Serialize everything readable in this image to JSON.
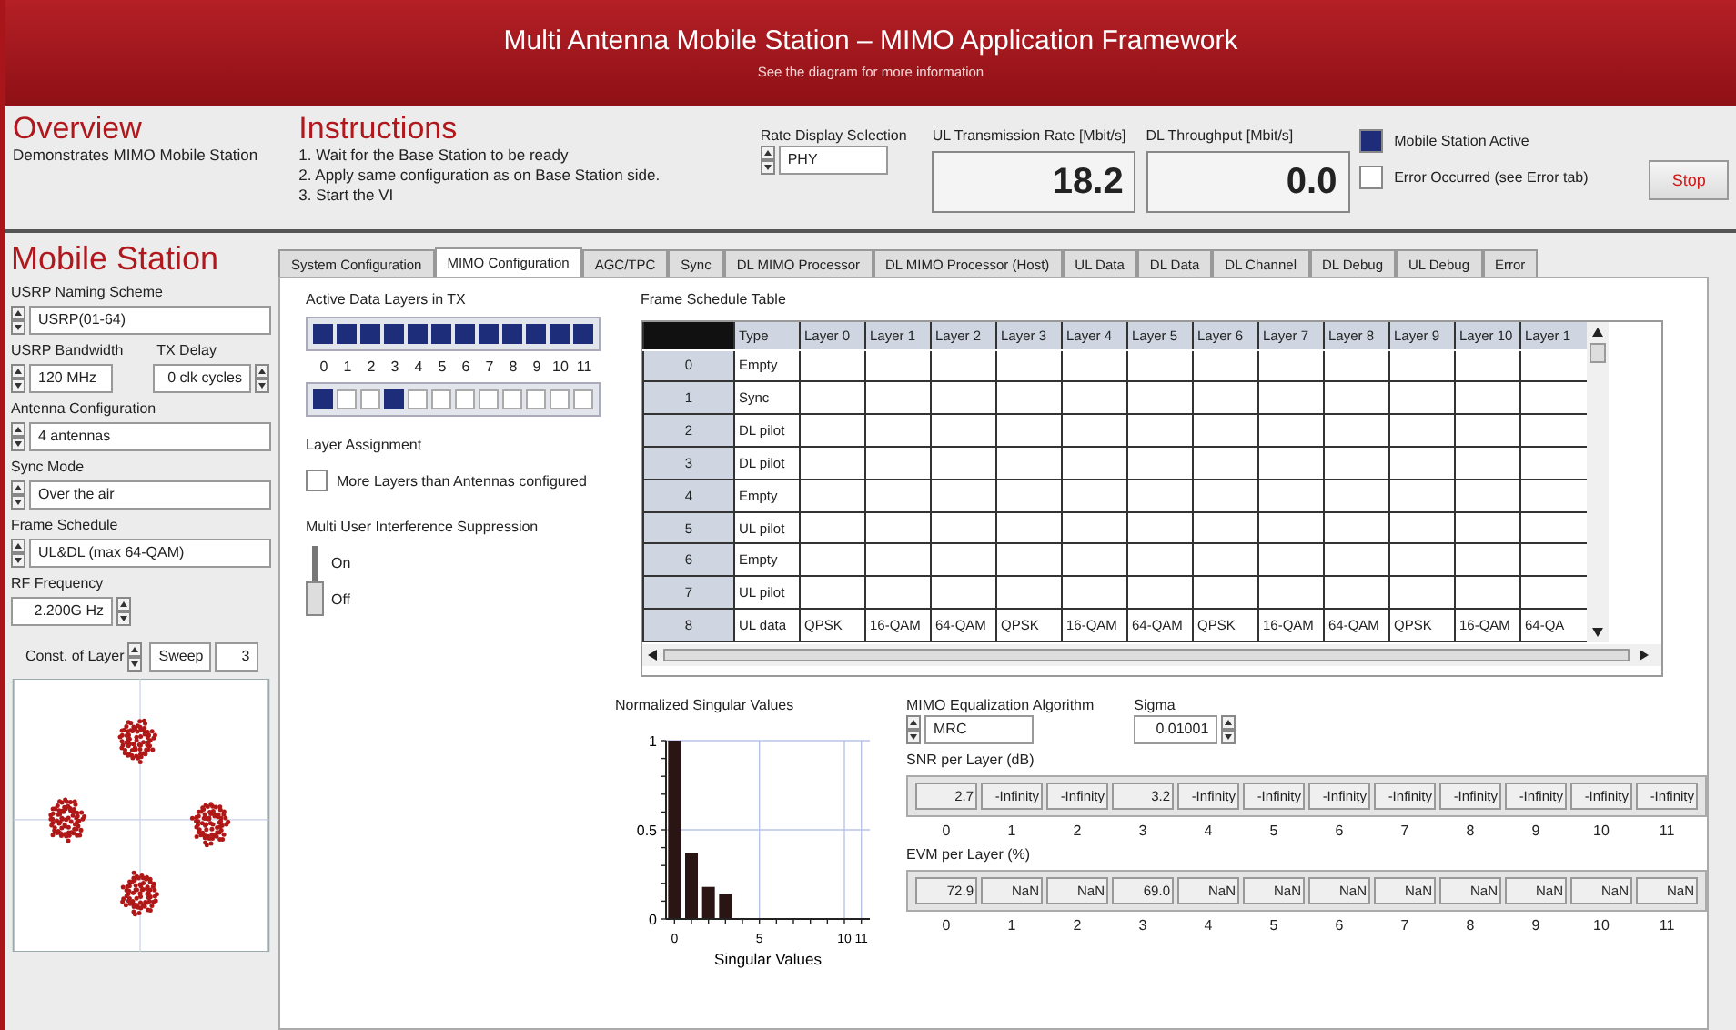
{
  "header": {
    "title": "Multi Antenna Mobile Station – MIMO Application Framework",
    "subtitle": "See the diagram for more information"
  },
  "overview": {
    "heading": "Overview",
    "text": "Demonstrates MIMO Mobile Station"
  },
  "instructions": {
    "heading": "Instructions",
    "steps": [
      "1. Wait for the Base Station to be ready",
      "2. Apply same configuration as on Base Station side.",
      "3. Start the VI"
    ]
  },
  "rate_display": {
    "label": "Rate Display Selection",
    "value": "PHY"
  },
  "indicators": [
    {
      "label": "UL Transmission Rate [Mbit/s]",
      "value": "18.2"
    },
    {
      "label": "DL Throughput [Mbit/s]",
      "value": "0.0"
    }
  ],
  "status_leds": [
    {
      "label": "Mobile Station Active",
      "on": true
    },
    {
      "label": "Error Occurred (see Error tab)",
      "on": false
    }
  ],
  "stop_button": "Stop",
  "mobile_station": {
    "heading": "Mobile Station",
    "naming_scheme": {
      "label": "USRP Naming Scheme",
      "value": "USRP(01-64)"
    },
    "bandwidth": {
      "label": "USRP Bandwidth",
      "value": "120 MHz"
    },
    "tx_delay": {
      "label": "TX Delay",
      "value": "0 clk cycles"
    },
    "antenna_config": {
      "label": "Antenna Configuration",
      "value": "4 antennas"
    },
    "sync_mode": {
      "label": "Sync Mode",
      "value": "Over the air"
    },
    "frame_schedule": {
      "label": "Frame Schedule",
      "value": "UL&DL (max 64-QAM)"
    },
    "rf_frequency": {
      "label": "RF Frequency",
      "value": "2.200G Hz"
    },
    "constellation": {
      "label": "Const. of Layer",
      "mode": "Sweep",
      "layer": "3"
    }
  },
  "tabs": [
    {
      "label": "System Configuration",
      "selected": false
    },
    {
      "label": "MIMO Configuration",
      "selected": true
    },
    {
      "label": "AGC/TPC",
      "selected": false
    },
    {
      "label": "Sync",
      "selected": false
    },
    {
      "label": "DL MIMO Processor",
      "selected": false
    },
    {
      "label": "DL MIMO Processor (Host)",
      "selected": false
    },
    {
      "label": "UL Data",
      "selected": false
    },
    {
      "label": "DL Data",
      "selected": false
    },
    {
      "label": "DL Channel",
      "selected": false
    },
    {
      "label": "DL Debug",
      "selected": false
    },
    {
      "label": "UL Debug",
      "selected": false
    },
    {
      "label": "Error",
      "selected": false
    }
  ],
  "active_layers": {
    "label": "Active Data Layers in TX",
    "tx": [
      true,
      true,
      true,
      true,
      true,
      true,
      true,
      true,
      true,
      true,
      true,
      true
    ],
    "indices": [
      "0",
      "1",
      "2",
      "3",
      "4",
      "5",
      "6",
      "7",
      "8",
      "9",
      "10",
      "11"
    ],
    "assignment": [
      true,
      false,
      false,
      true,
      false,
      false,
      false,
      false,
      false,
      false,
      false,
      false
    ],
    "assignment_label": "Layer Assignment"
  },
  "more_layers": {
    "label": "More Layers than Antennas configured",
    "checked": false
  },
  "interference": {
    "label": "Multi User Interference Suppression",
    "on": false,
    "on_label": "On",
    "off_label": "Off"
  },
  "frame_table": {
    "title": "Frame Schedule Table",
    "columns": [
      "Type",
      "Layer 0",
      "Layer 1",
      "Layer 2",
      "Layer 3",
      "Layer 4",
      "Layer 5",
      "Layer 6",
      "Layer 7",
      "Layer 8",
      "Layer 9",
      "Layer 10",
      "Layer 1"
    ],
    "rows": [
      {
        "index": "0",
        "type": "Empty"
      },
      {
        "index": "1",
        "type": "Sync"
      },
      {
        "index": "2",
        "type": "DL pilot"
      },
      {
        "index": "3",
        "type": "DL pilot"
      },
      {
        "index": "4",
        "type": "Empty"
      },
      {
        "index": "5",
        "type": "UL pilot"
      },
      {
        "index": "6",
        "type": "Empty"
      },
      {
        "index": "7",
        "type": "UL pilot"
      },
      {
        "index": "8",
        "type": "UL data",
        "cells": [
          "QPSK",
          "16-QAM",
          "64-QAM",
          "QPSK",
          "16-QAM",
          "64-QAM",
          "QPSK",
          "16-QAM",
          "64-QAM",
          "QPSK",
          "16-QAM",
          "64-QA"
        ]
      }
    ]
  },
  "singular_values": {
    "chart_data": {
      "type": "bar",
      "title": "Normalized Singular Values",
      "xlabel": "Singular Values",
      "x": [
        0,
        1,
        2,
        3
      ],
      "values": [
        1,
        0.37,
        0.18,
        0.14
      ],
      "xlim": [
        -0.5,
        11.5
      ],
      "ylim": [
        0,
        1
      ],
      "xticks": [
        0,
        5,
        10,
        11
      ],
      "yticks": [
        0,
        0.5,
        1
      ],
      "grid": true
    }
  },
  "equalization": {
    "label": "MIMO Equalization Algorithm",
    "value": "MRC"
  },
  "sigma": {
    "label": "Sigma",
    "value": "0.01001"
  },
  "snr": {
    "label": "SNR per Layer (dB)",
    "values": [
      "2.7",
      "-Infinity",
      "-Infinity",
      "3.2",
      "-Infinity",
      "-Infinity",
      "-Infinity",
      "-Infinity",
      "-Infinity",
      "-Infinity",
      "-Infinity",
      "-Infinity"
    ],
    "indices": [
      "0",
      "1",
      "2",
      "3",
      "4",
      "5",
      "6",
      "7",
      "8",
      "9",
      "10",
      "11"
    ]
  },
  "evm": {
    "label": "EVM per Layer (%)",
    "values": [
      "72.9",
      "NaN",
      "NaN",
      "69.0",
      "NaN",
      "NaN",
      "NaN",
      "NaN",
      "NaN",
      "NaN",
      "NaN",
      "NaN"
    ],
    "indices": [
      "0",
      "1",
      "2",
      "3",
      "4",
      "5",
      "6",
      "7",
      "8",
      "9",
      "10",
      "11"
    ]
  }
}
